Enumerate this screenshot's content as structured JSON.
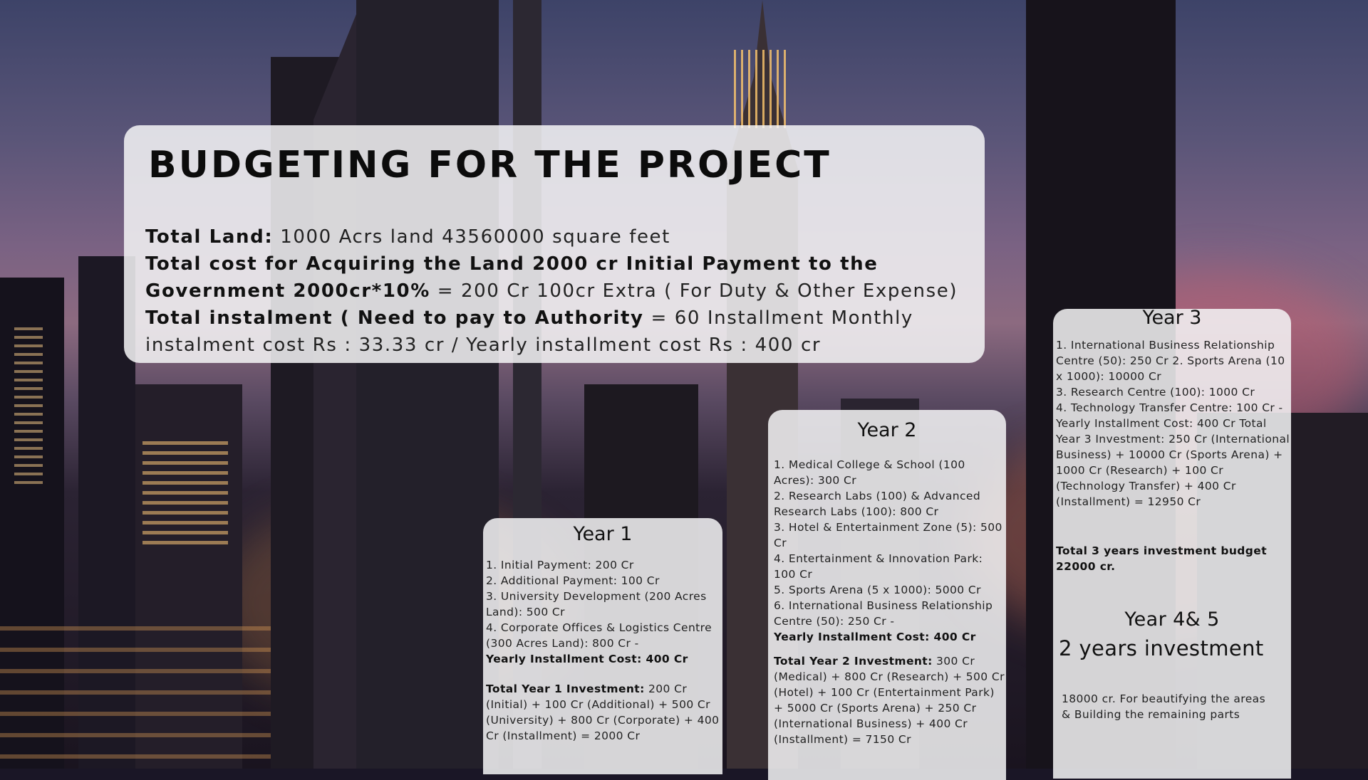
{
  "title": "BUDGETING FOR THE PROJECT",
  "summary": {
    "land_label": "Total Land:",
    "land_text": " 1000 Acrs land 43560000 square feet",
    "cost_label": "Total cost for Acquiring the Land 2000 cr Initial Payment to the Government 2000cr*10%",
    "cost_text": " = 200 Cr 100cr Extra ( For Duty & Other Expense)",
    "instalment_label": "Total instalment ( Need to pay to Authority",
    "instalment_text": " = 60 Installment Monthly instalment cost Rs : 33.33 cr / Yearly installment cost Rs : 400 cr"
  },
  "year1": {
    "heading": "Year 1",
    "items": [
      "1. Initial Payment: 200 Cr",
      "2. Additional Payment: 100 Cr",
      "3. University Development (200 Acres Land): 500 Cr",
      "4. Corporate Offices & Logistics Centre (300 Acres Land): 800 Cr -"
    ],
    "installment": "Yearly Installment Cost: 400 Cr",
    "total_label": "Total Year 1 Investment:",
    "total_text": " 200 Cr (Initial) + 100 Cr (Additional) + 500 Cr (University) + 800 Cr (Corporate) + 400 Cr (Installment) = 2000 Cr"
  },
  "year2": {
    "heading": "Year 2",
    "items": [
      "1. Medical College & School (100 Acres): 300 Cr",
      "2. Research Labs (100) & Advanced Research Labs (100): 800 Cr",
      "3. Hotel & Entertainment Zone (5): 500 Cr",
      "4. Entertainment & Innovation Park: 100 Cr",
      "5. Sports Arena (5 x 1000): 5000 Cr",
      "6. International Business Relationship Centre (50): 250 Cr -"
    ],
    "installment": "Yearly Installment Cost: 400 Cr",
    "total_label": "Total Year 2 Investment:",
    "total_text": " 300 Cr (Medical) + 800 Cr (Research) + 500 Cr (Hotel) + 100 Cr (Entertainment Park) + 5000 Cr (Sports Arena) + 250 Cr (International Business) + 400 Cr (Installment) = 7150 Cr"
  },
  "year3": {
    "heading": "Year 3",
    "items": [
      "1. International Business Relationship Centre (50): 250 Cr 2. Sports Arena (10 x 1000): 10000 Cr",
      "3. Research Centre (100): 1000 Cr",
      "4. Technology Transfer Centre: 100 Cr - Yearly Installment Cost: 400 Cr Total Year 3 Investment: 250 Cr (International Business) + 10000 Cr (Sports Arena) + 1000 Cr (Research) + 100 Cr (Technology Transfer) + 400 Cr (Installment) = 12950 Cr"
    ],
    "total": "Total 3 years investment budget 22000 cr."
  },
  "year45": {
    "heading": "Year 4& 5",
    "subheading": "2 years investment",
    "text": "18000 cr. For beautifying the areas & Building the remaining parts"
  }
}
